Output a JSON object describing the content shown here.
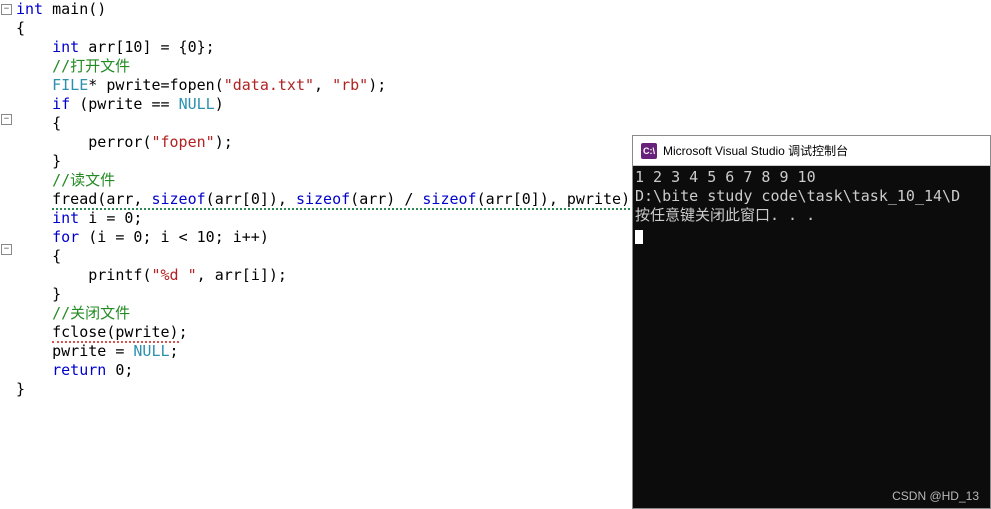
{
  "editor": {
    "outline": {
      "collapse_glyph": "−"
    },
    "tokens": {
      "int": "int",
      "main_name": "main",
      "arr_name": "arr",
      "arr_size": "10",
      "zero": "0",
      "open_cmt": "//打开文件",
      "FILE": "FILE",
      "pwrite": "pwrite",
      "fopen": "fopen",
      "data_txt": "\"data.txt\"",
      "rb": "\"rb\"",
      "if": "if",
      "NULL": "NULL",
      "perror": "perror",
      "fopen_str": "\"fopen\"",
      "read_cmt": "//读文件",
      "fread": "fread",
      "sizeof": "sizeof",
      "i_name": "i",
      "for": "for",
      "ten": "10",
      "printf": "printf",
      "fmt": "\"%d \"",
      "close_cmt": "//关闭文件",
      "fclose": "fclose",
      "return": "return"
    }
  },
  "console": {
    "title_icon": "C:\\",
    "title": "Microsoft Visual Studio 调试控制台",
    "output_line": "1 2 3 4 5 6 7 8 9 10",
    "path_line": "D:\\bite study code\\task\\task_10_14\\D",
    "close_line": "按任意键关闭此窗口. . ."
  },
  "watermark": "CSDN @HD_13"
}
